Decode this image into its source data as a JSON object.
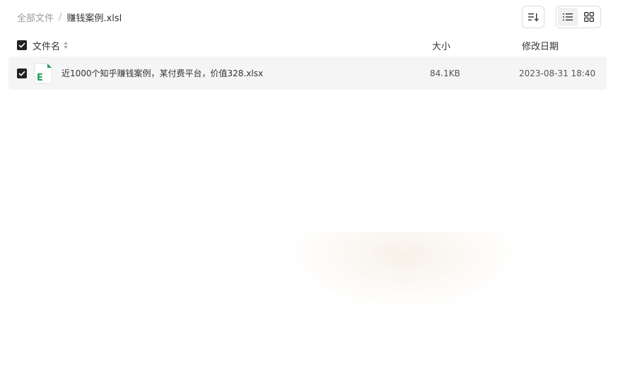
{
  "breadcrumb": {
    "root": "全部文件",
    "separator": "/",
    "current": "赚钱案例.xlsl"
  },
  "toolbar": {
    "sort_icon": "sort-icon",
    "list_view_icon": "list-view-icon",
    "grid_view_icon": "grid-view-icon",
    "active_view": "list"
  },
  "table": {
    "headers": {
      "name": "文件名",
      "size": "大小",
      "date": "修改日期"
    },
    "rows": [
      {
        "name": "近1000个知乎赚钱案例，某付费平台，价值328.xlsx",
        "size": "84.1KB",
        "date": "2023-08-31 18:40",
        "checked": true,
        "icon": "excel-file-icon"
      }
    ]
  },
  "colors": {
    "excel_green": "#1f9d55",
    "row_bg": "#f5f5f5",
    "checkbox": "#222222"
  }
}
